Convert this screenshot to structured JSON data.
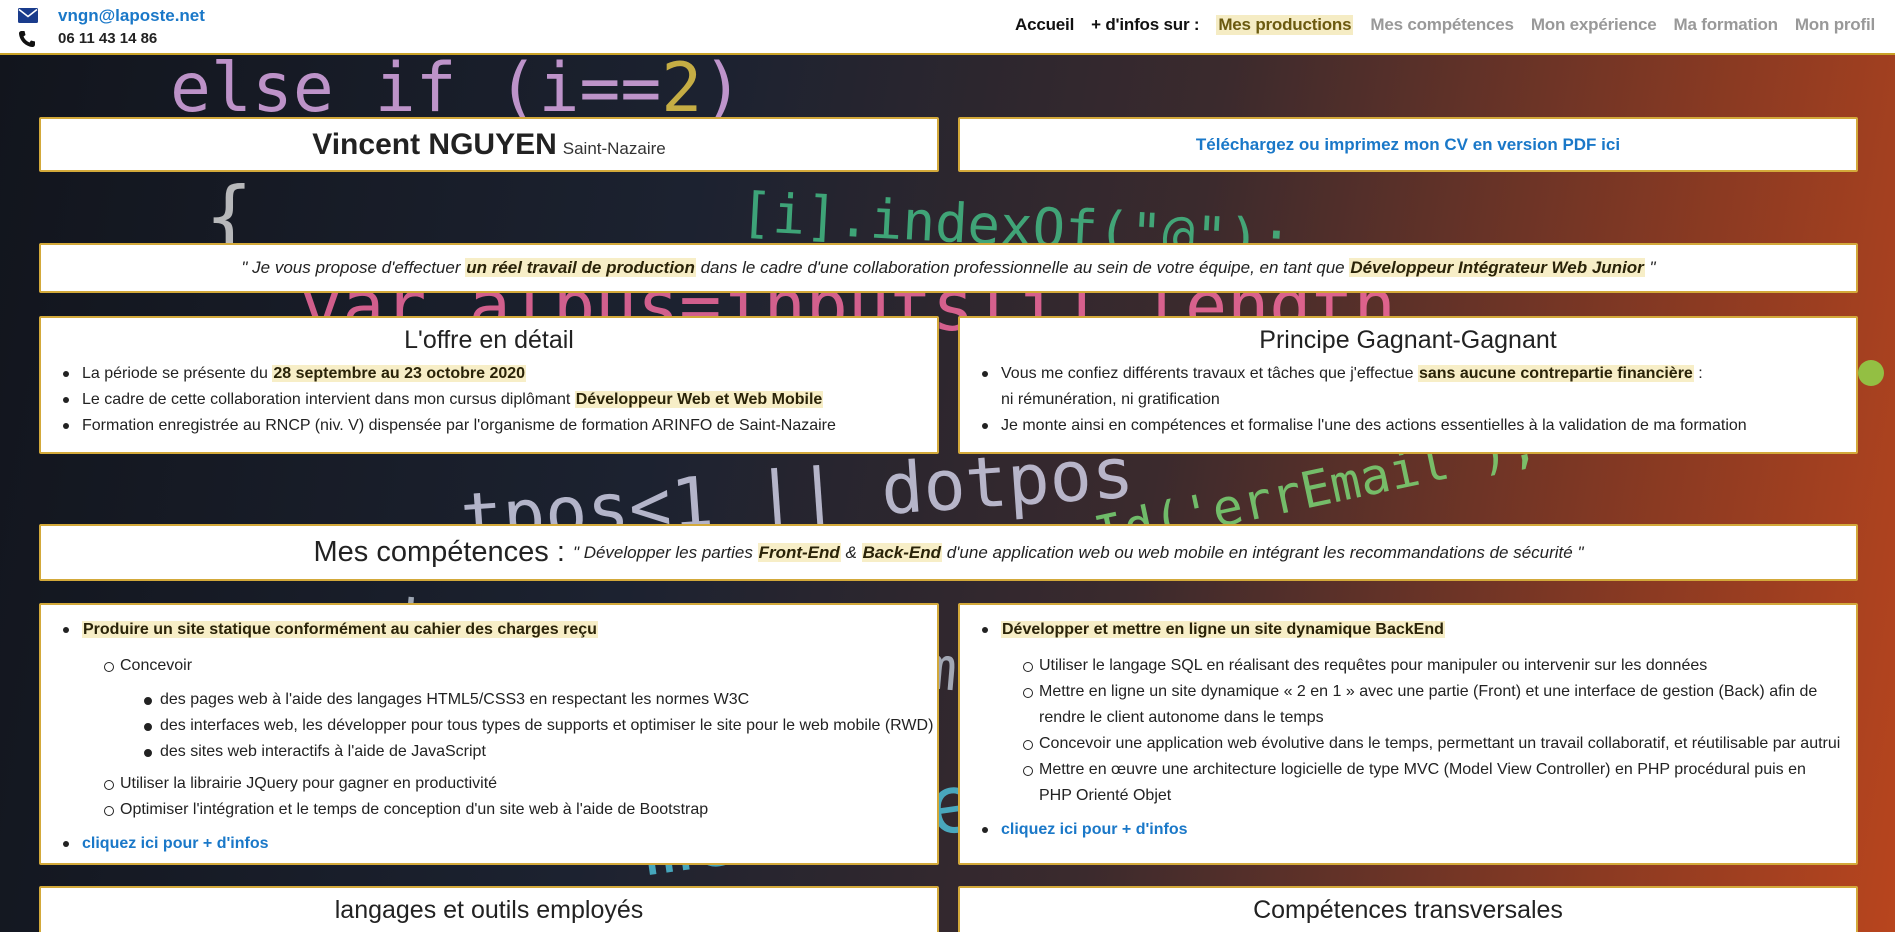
{
  "contact": {
    "email": "vngn@laposte.net",
    "phone": "06 11 43 14 86"
  },
  "nav": {
    "home": "Accueil",
    "more_label": "+ d'infos sur :",
    "items": [
      "Mes productions",
      "Mes compétences",
      "Mon expérience",
      "Ma formation",
      "Mon profil"
    ]
  },
  "profile": {
    "name": "Vincent NGUYEN",
    "city": "Saint-Nazaire",
    "pdf_link": "Téléchargez ou imprimez mon CV en version PDF ici"
  },
  "quote": {
    "part1": "\" Je vous propose d'effectuer ",
    "hl1": "un réel travail de production",
    "part2": " dans le cadre d'une collaboration professionnelle au sein de votre équipe, en tant que ",
    "hl2": "Développeur Intégrateur Web Junior",
    "part3": " \""
  },
  "offer": {
    "title": "L'offre en détail",
    "items": [
      {
        "text": "La période se présente du ",
        "hl": "28 septembre au 23 octobre 2020"
      },
      {
        "text": "Le cadre de cette collaboration intervient dans mon cursus diplômant ",
        "hl": "Développeur Web et Web Mobile"
      },
      {
        "text": "Formation enregistrée au RNCP (niv. V) dispensée par l'organisme de formation ARINFO de Saint-Nazaire",
        "hl": ""
      }
    ]
  },
  "winwin": {
    "title": "Principe Gagnant-Gagnant",
    "item1_text": "Vous me confiez différents travaux et tâches que j'effectue ",
    "item1_hl": "sans aucune contrepartie financière",
    "item1_tail": " :",
    "item1_line2": "ni rémunération, ni gratification",
    "item2": "Je monte ainsi en compétences et formalise l'une des actions essentielles à la validation de ma formation"
  },
  "skills_header": {
    "title": "Mes compétences :",
    "sub1": "\" Développer les parties ",
    "hl1": "Front-End",
    "amp": " & ",
    "hl2": "Back-End",
    "sub2": " d'une application web ou web mobile en intégrant les recommandations de sécurité \""
  },
  "front": {
    "heading": "Produire un site statique conformément au cahier des charges reçu",
    "design": "Concevoir",
    "design_items": [
      "des pages web à l'aide des langages HTML5/CSS3 en respectant les normes W3C",
      "des interfaces web, les développer pour tous types de supports et optimiser le site pour le web mobile (RWD)",
      "des sites web interactifs à l'aide de JavaScript"
    ],
    "others": [
      "Utiliser la librairie JQuery pour gagner en productivité",
      "Optimiser l'intégration et le temps de conception d'un site web à l'aide de Bootstrap"
    ],
    "link": "cliquez ici pour + d'infos"
  },
  "back": {
    "heading": "Développer et mettre en ligne un site dynamique BackEnd",
    "items": [
      "Utiliser le langage SQL en réalisant des requêtes pour manipuler ou intervenir sur les données",
      "Mettre en ligne un site dynamique « 2 en 1 » avec une partie (Front) et une interface de gestion (Back) afin de rendre le client autonome dans le temps",
      "Concevoir une application web évolutive dans le temps, permettant un travail collaboratif, et réutilisable par autrui",
      "Mettre en œuvre une architecture logicielle de type MVC (Model View Controller) en PHP procédural puis en PHP Orienté Objet"
    ],
    "link": "cliquez ici pour + d'infos"
  },
  "sections": {
    "tools_title": "langages et outils employés",
    "transversal_title": "Compétences transversales"
  },
  "icons": {
    "email": "envelope-icon",
    "phone": "phone-icon"
  },
  "colors": {
    "accent_border": "#d3a93a",
    "link": "#1a78c8",
    "highlight_bg": "#f7eec7"
  }
}
